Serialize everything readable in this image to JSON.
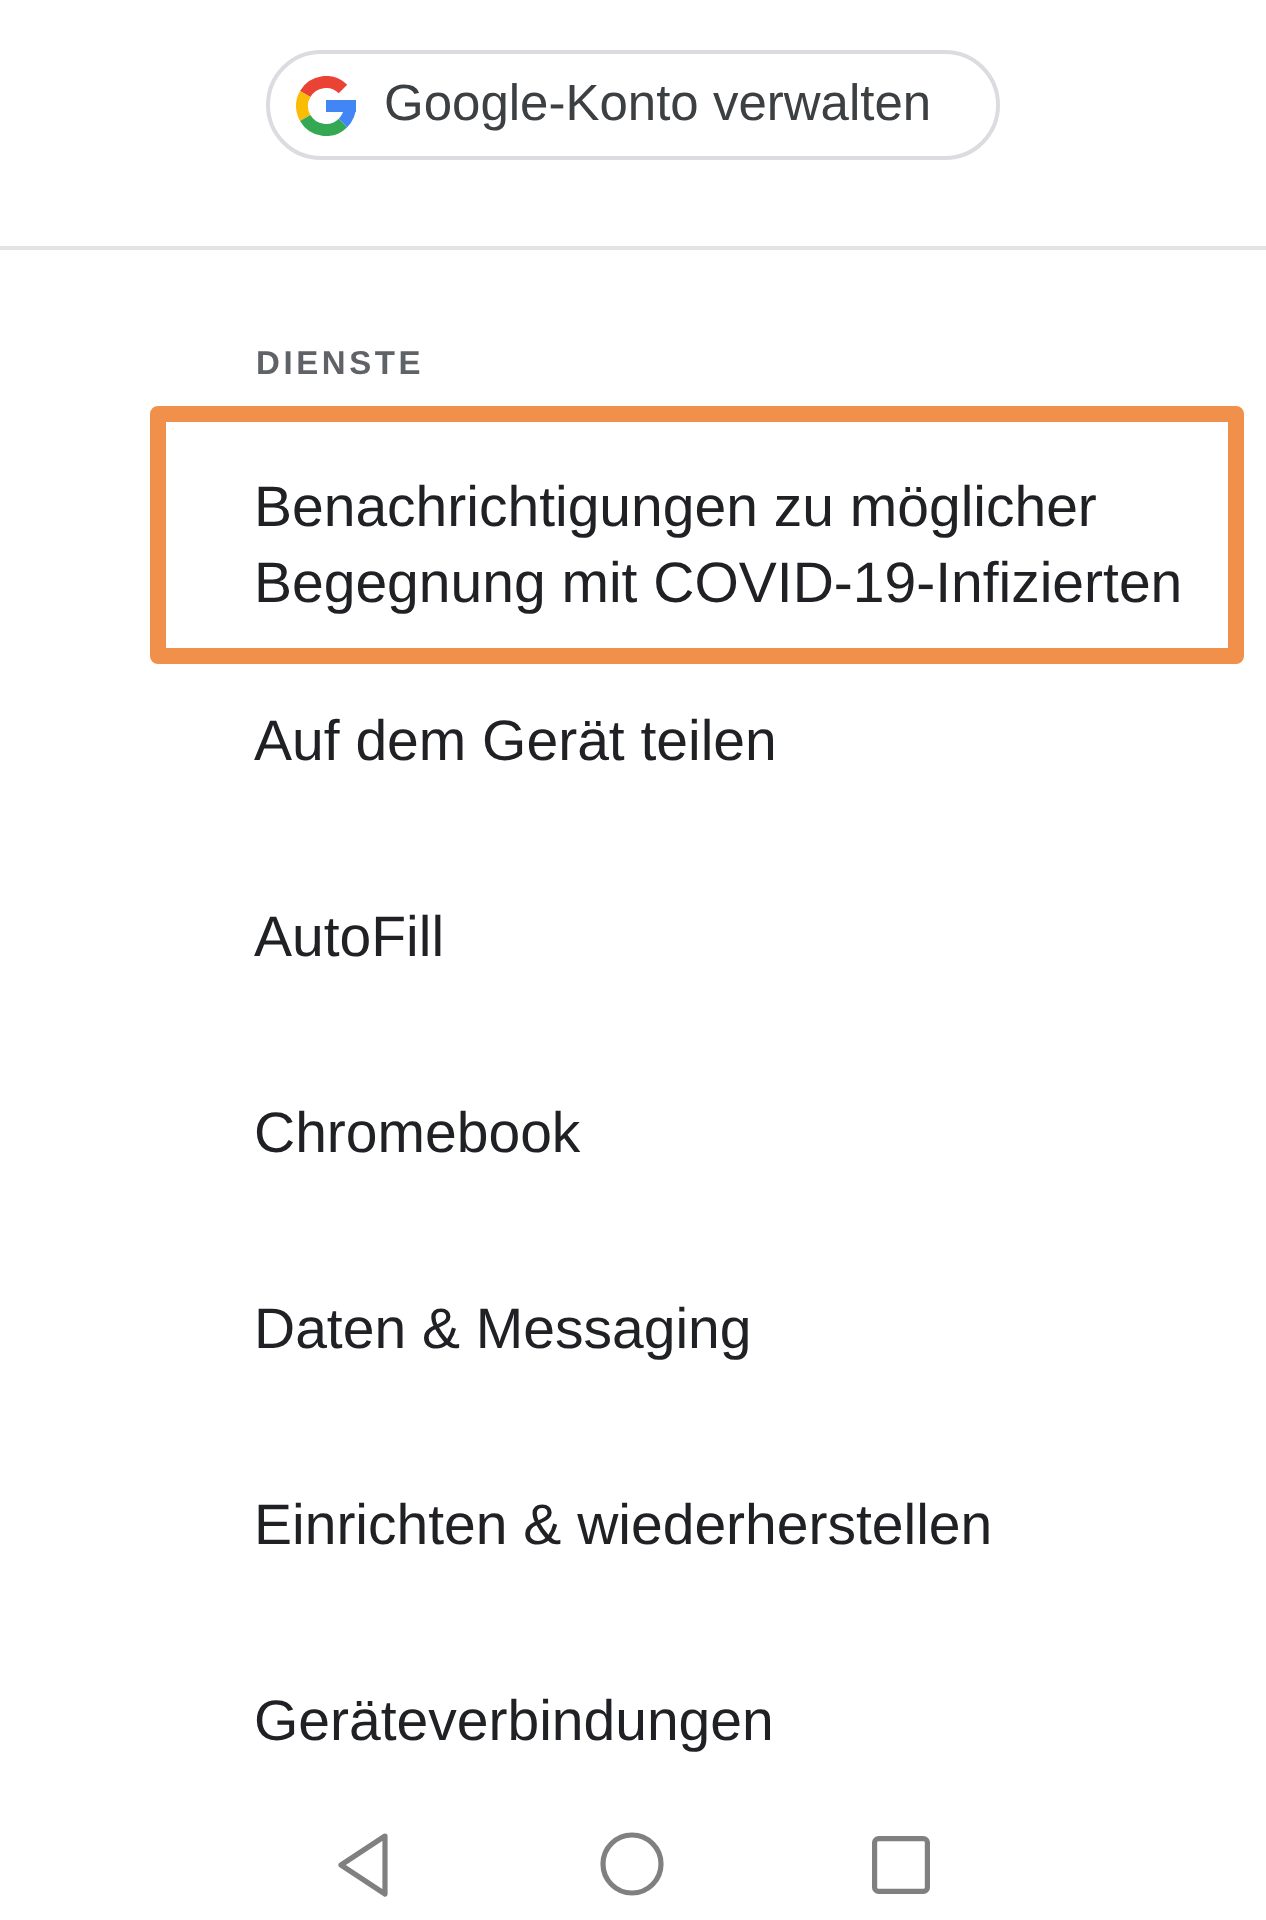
{
  "account_button": {
    "label": "Google-Konto verwalten"
  },
  "section": {
    "title": "DIENSTE",
    "items": [
      {
        "label": "Benachrichtigungen zu möglicher Begegnung mit COVID-19-Infizierten",
        "highlighted": true
      },
      {
        "label": "Auf dem Gerät teilen",
        "highlighted": false
      },
      {
        "label": "AutoFill",
        "highlighted": false
      },
      {
        "label": "Chromebook",
        "highlighted": false
      },
      {
        "label": "Daten & Messaging",
        "highlighted": false
      },
      {
        "label": "Einrichten & wiederherstellen",
        "highlighted": false
      },
      {
        "label": "Geräteverbindungen",
        "highlighted": false
      }
    ]
  }
}
